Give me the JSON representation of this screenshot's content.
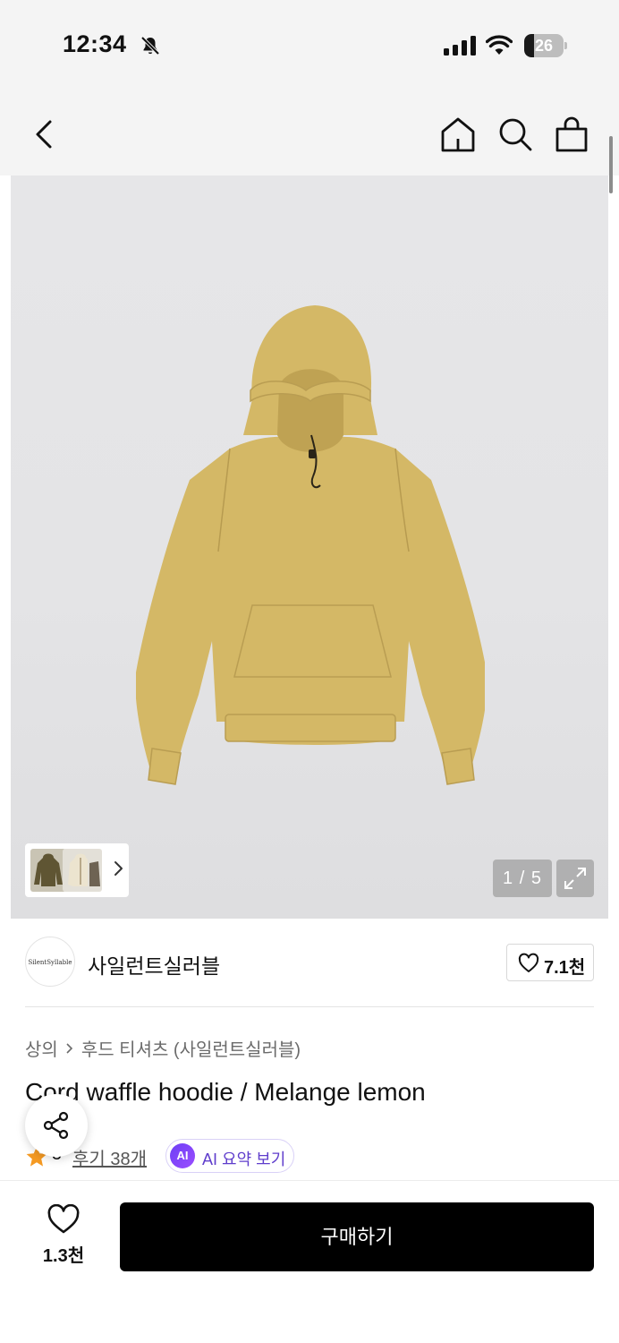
{
  "status_bar": {
    "time": "12:34",
    "battery": "26",
    "battery_level_percent": 26,
    "icons": [
      "bell-off-icon",
      "signal-icon",
      "wifi-icon",
      "battery-icon"
    ]
  },
  "nav": {
    "icons": [
      "back-arrow-icon",
      "home-icon",
      "search-icon",
      "shopping-bag-icon"
    ]
  },
  "gallery": {
    "page_indicator": "1 / 5",
    "thumbnail_colors": [
      "#7a6f44",
      "#e7dfc9",
      "#8a7f70"
    ],
    "main_image_color": "#d4b866"
  },
  "brand": {
    "logo_text": "SilentSyllable",
    "name": "사일런트실러블",
    "like_count": "7.1천"
  },
  "breadcrumb": {
    "category": "상의",
    "subcategory": "후드 티셔츠 (사일런트실러블)"
  },
  "product": {
    "title": "Cord waffle hoodie / Melange lemon"
  },
  "rating": {
    "value": "5",
    "review_label": "후기 38개",
    "ai_badge": "AI",
    "ai_summary_label": "AI 요약 보기"
  },
  "bottom_bar": {
    "wish_count": "1.3천",
    "buy_label": "구매하기"
  },
  "colors": {
    "accent_star": "#f59a23",
    "ai_purple": "#6d3ff5",
    "buy_button": "#000000"
  }
}
